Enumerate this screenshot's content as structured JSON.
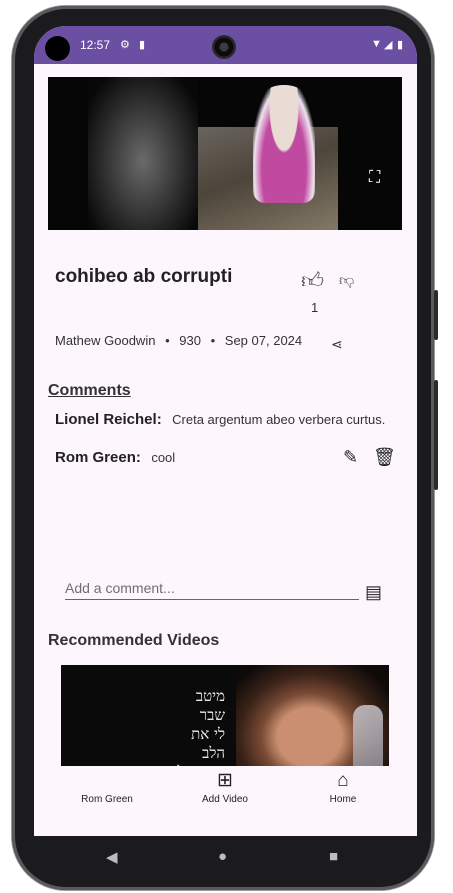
{
  "status_bar": {
    "time": "12:57",
    "icons": [
      "settings-icon",
      "sd-card-icon",
      "wifi-icon",
      "signal-icon",
      "battery-icon"
    ]
  },
  "video": {
    "title": "cohibeo ab corrupti",
    "like_count": "1",
    "uploader": "Mathew Goodwin",
    "views": "930",
    "date": "Sep 07, 2024"
  },
  "comments": {
    "heading": "Comments",
    "items": [
      {
        "author": "Lionel Reichel:",
        "text": "Creta argentum abeo verbera curtus."
      },
      {
        "author": "Rom Green:",
        "text": "cool"
      }
    ],
    "input_placeholder": "Add a comment..."
  },
  "recommended": {
    "heading": "Recommended Videos",
    "thumbnail_text": "מיטב\nשבר\nלי את\nהלב\nשחר אלמוג"
  },
  "bottom_nav": {
    "items": [
      {
        "label": "Rom Green",
        "icon": "profile-icon"
      },
      {
        "label": "Add Video",
        "icon": "video-add-icon"
      },
      {
        "label": "Home",
        "icon": "home-icon"
      }
    ]
  },
  "colors": {
    "status_bar": "#6b4fa3",
    "background": "#fdf7fd",
    "text": "#222222"
  }
}
